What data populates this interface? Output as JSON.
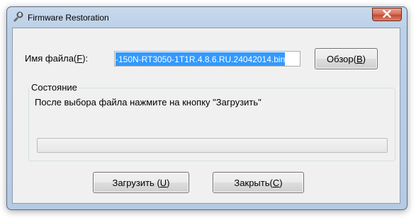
{
  "window": {
    "title": "Firmware Restoration",
    "app_icon": "firmware-tool-icon",
    "close_icon": "close-icon"
  },
  "file": {
    "label_text": "Имя файла(",
    "label_mnemonic": "F",
    "label_suffix": "):",
    "value": "-150N-RT3050-1T1R.4.8.6.RU.24042014.bin"
  },
  "browse_button": {
    "text": "Обзор(",
    "mnemonic": "B",
    "suffix": ")"
  },
  "status": {
    "group_title": "Состояние",
    "message": "После выбора файла нажмите на кнопку \"Загрузить\"",
    "progress": 0
  },
  "buttons": {
    "load": {
      "text": "Загрузить (",
      "mnemonic": "U",
      "suffix": ")"
    },
    "close": {
      "text": "Закрыть(",
      "mnemonic": "C",
      "suffix": ")"
    }
  },
  "colors": {
    "selection": "#3399ff",
    "close_button": "#c74a32",
    "progress_fill": "#06b025"
  }
}
